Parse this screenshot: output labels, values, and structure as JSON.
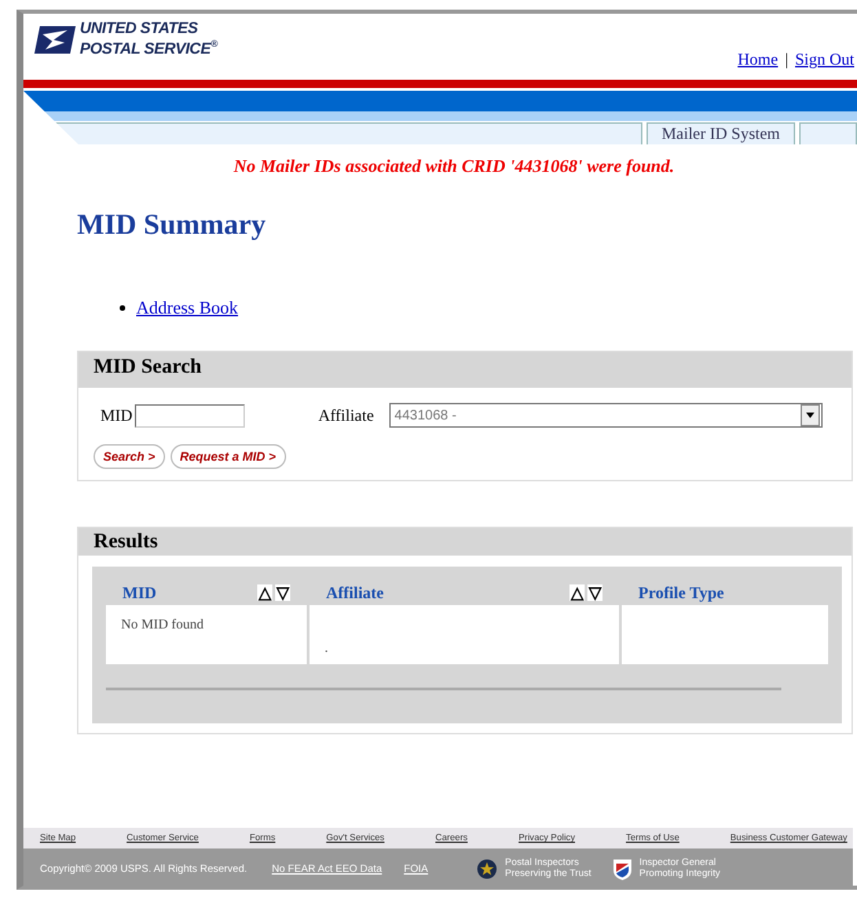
{
  "header": {
    "logo_line_1": "UNITED STATES",
    "logo_line_2": "POSTAL SERVICE",
    "logo_mark": "®",
    "links": [
      "Home",
      "Sign Out"
    ],
    "separator": "|"
  },
  "nav_tabs": [
    {
      "kind": "blank",
      "selected": false
    },
    {
      "kind": "text",
      "label": "Mailer ID System",
      "selected": false
    },
    {
      "kind": "blank",
      "selected": false
    }
  ],
  "error_message": "No Mailer IDs associated with CRID '4431068' were found.",
  "page_title": "MID Summary",
  "links": [
    "Address Book"
  ],
  "search_panel": {
    "title": "MID Search",
    "mid_label": "MID",
    "affiliate_label": "Affiliate",
    "affiliate_value": "4431068 -",
    "buttons": [
      "Search >",
      "Request a MID >"
    ]
  },
  "results_panel": {
    "title": "Results",
    "columns": [
      {
        "label": "MID",
        "sortable": true
      },
      {
        "label": "Affiliate",
        "sortable": true
      },
      {
        "label": "Profile Type",
        "sortable": false
      }
    ],
    "sort_up": "△",
    "sort_down": "▽",
    "rows": [
      [
        "No MID found",
        ".",
        ""
      ]
    ]
  },
  "footer": {
    "links": [
      "Site Map",
      "Customer Service",
      "Forms",
      "Gov't Services",
      "Careers",
      "Privacy Policy",
      "Terms of Use",
      "Business Customer Gateway"
    ],
    "copyright": "Copyright© 2009 USPS. All Rights Reserved.",
    "bottom_links": [
      "No FEAR Act EEO Data",
      "FOIA"
    ],
    "badges": [
      {
        "kind": "star",
        "line_1": "Postal Inspectors",
        "line_2": "Preserving the Trust"
      },
      {
        "kind": "shield",
        "line_1": "Inspector General",
        "line_2": "Promoting Integrity"
      }
    ]
  }
}
